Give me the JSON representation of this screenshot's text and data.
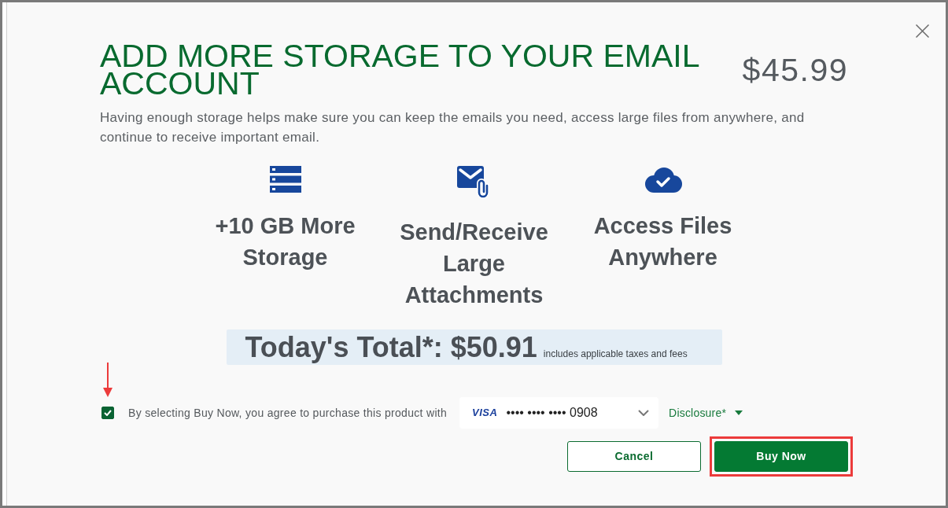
{
  "dialog": {
    "title": "ADD MORE STORAGE TO YOUR EMAIL ACCOUNT",
    "price": "$45.99",
    "description": "Having enough storage helps make sure you can keep the emails you need, access large files from anywhere, and continue to receive important email."
  },
  "features": [
    {
      "kind": "storage",
      "label": "+10 GB More Storage"
    },
    {
      "kind": "mail",
      "label": "Send/Receive Large Attachments"
    },
    {
      "kind": "cloud",
      "label": "Access Files Anywhere"
    }
  ],
  "total": {
    "label": "Today's Total*: $50.91",
    "note": "includes applicable taxes and fees"
  },
  "consent": {
    "checked": true,
    "callout": true,
    "text": "By selecting Buy Now, you agree to purchase this product with"
  },
  "payment": {
    "brand": "VISA",
    "number": "•••• •••• •••• 0908"
  },
  "disclosure": {
    "label": "Disclosure*"
  },
  "buttons": [
    {
      "label": "Cancel",
      "kind": "secondary",
      "highlighted": false
    },
    {
      "label": "Buy Now",
      "kind": "primary",
      "highlighted": true
    }
  ]
}
